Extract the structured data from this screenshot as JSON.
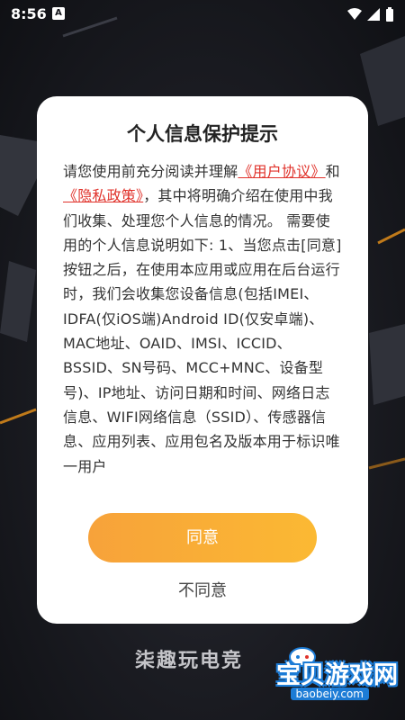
{
  "status_bar": {
    "time": "8:56",
    "notification_icon": "A"
  },
  "dialog": {
    "title": "个人信息保护提示",
    "body_intro": "请您使用前充分阅读并理解",
    "link_user_agreement": "《用户协议》",
    "and": "和",
    "link_privacy_policy": "《隐私政策》",
    "body_rest": "，其中将明确介绍在使用中我们收集、处理您个人信息的情况。 需要使用的个人信息说明如下: 1、当您点击[同意]按钮之后，在使用本应用或应用在后台运行时，我们会收集您设备信息(包括IMEI、IDFA(仅iOS端)Android ID(仅安卓端)、MAC地址、OAID、IMSI、ICCID、BSSID、SN号码、MCC+MNC、设备型号)、IP地址、访问日期和时间、网络日志信息、WIFI网络信息（SSID）、传感器信息、应用列表、应用包名及版本用于标识唯一用户",
    "agree_label": "同意",
    "disagree_label": "不同意"
  },
  "background": {
    "brand_text": "柒趣玩电竞"
  },
  "watermark": {
    "text": "宝贝游戏网",
    "url": "baobeiy.com"
  },
  "colors": {
    "accent_orange": "#f7a23a",
    "link_red": "#e0322b",
    "watermark_blue": "#1d7cd6"
  }
}
